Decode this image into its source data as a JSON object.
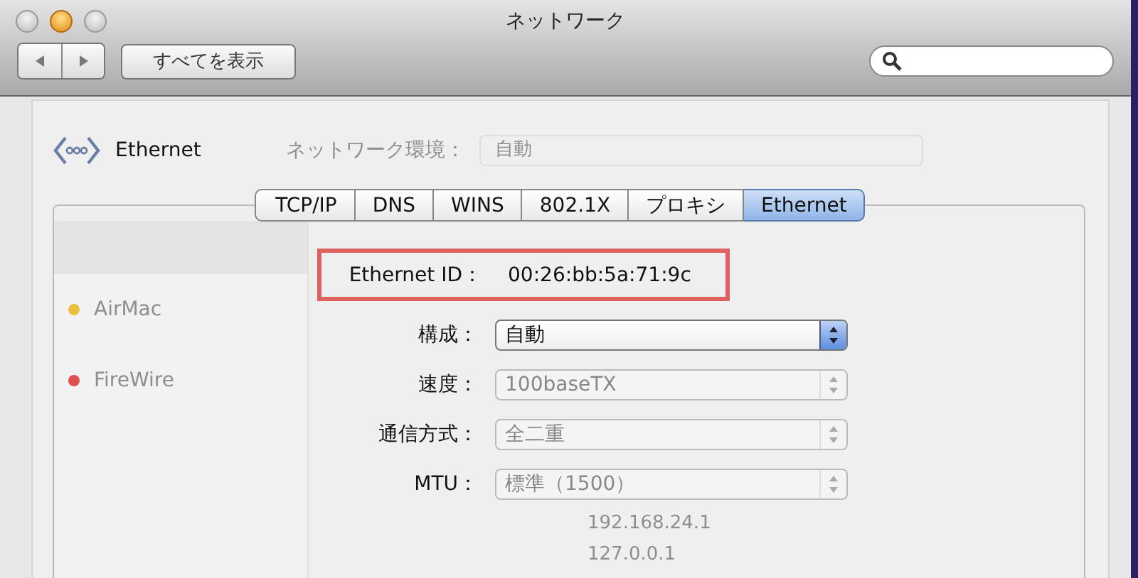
{
  "window": {
    "title": "ネットワーク"
  },
  "toolbar": {
    "show_all": "すべてを表示"
  },
  "header": {
    "service": "Ethernet"
  },
  "background": {
    "location_label": "ネットワーク環境：",
    "location_value": "自動",
    "services": [
      {
        "name": "AirMac",
        "color": "#e8c040"
      },
      {
        "name": "FireWire",
        "color": "#e05050"
      }
    ],
    "router": "192.168.24.1",
    "dns": "127.0.0.1"
  },
  "tabs": [
    {
      "label": "TCP/IP",
      "selected": false
    },
    {
      "label": "DNS",
      "selected": false
    },
    {
      "label": "WINS",
      "selected": false
    },
    {
      "label": "802.1X",
      "selected": false
    },
    {
      "label": "プロキシ",
      "selected": false
    },
    {
      "label": "Ethernet",
      "selected": true
    }
  ],
  "ethernet_id": {
    "label": "Ethernet ID：",
    "value": "00:26:bb:5a:71:9c",
    "highlighted": true
  },
  "fields": [
    {
      "label": "構成：",
      "value": "自動",
      "disabled": false
    },
    {
      "label": "速度：",
      "value": "100baseTX",
      "disabled": true
    },
    {
      "label": "通信方式：",
      "value": "全二重",
      "disabled": true
    },
    {
      "label": "MTU：",
      "value": "標準（1500）",
      "disabled": true
    }
  ]
}
